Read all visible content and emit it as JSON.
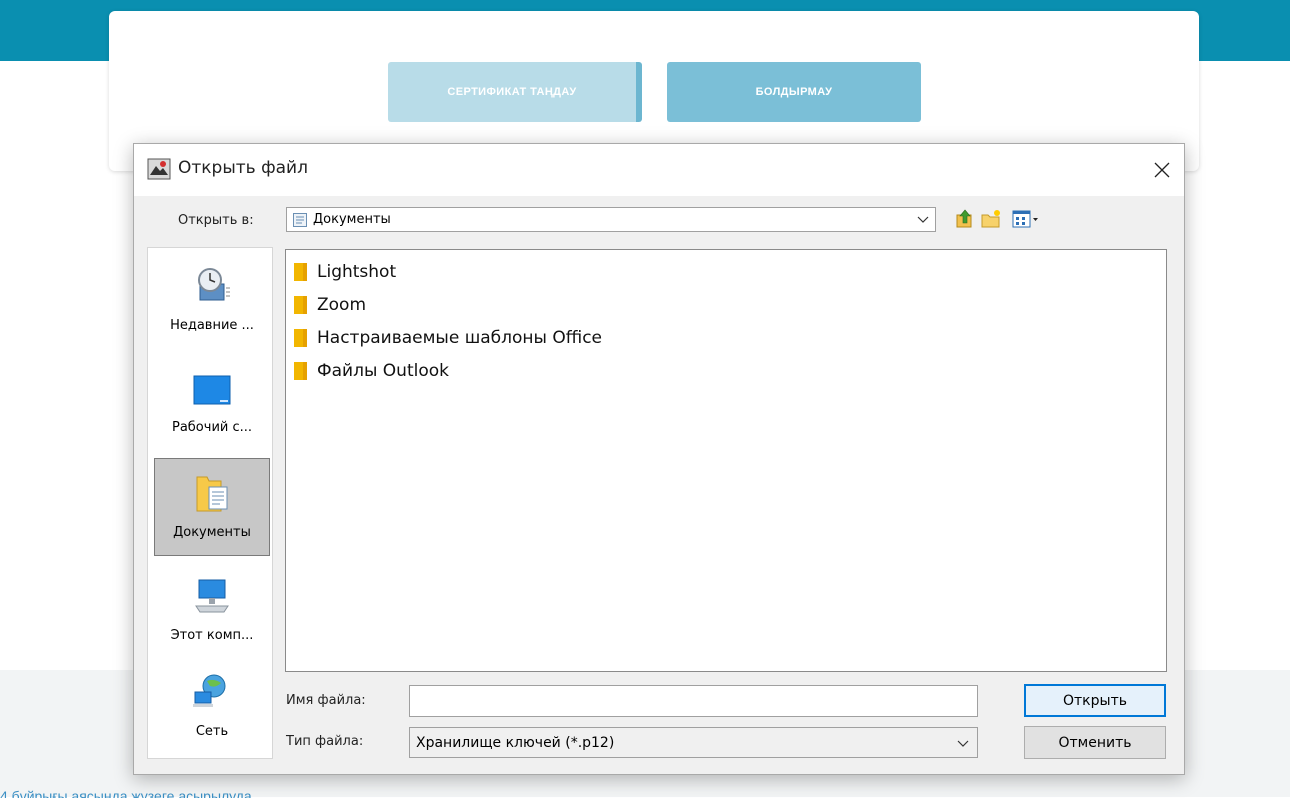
{
  "page": {
    "select_certificate_label": "СЕРТИФИКАТ ТАҢДАУ",
    "cancel_label": "БОЛДЫРМАУ",
    "footer_link_text": "4 бұйрығы аясында жүзеге асырылуда"
  },
  "dialog": {
    "title": "Открыть файл",
    "look_in_label": "Открыть в:",
    "look_in_value": "Документы",
    "places": [
      {
        "label": "Недавние ...",
        "icon": "recent-items-icon"
      },
      {
        "label": "Рабочий с...",
        "icon": "desktop-icon"
      },
      {
        "label": "Документы",
        "icon": "documents-icon",
        "selected": true
      },
      {
        "label": "Этот комп...",
        "icon": "computer-icon"
      },
      {
        "label": "Сеть",
        "icon": "network-icon"
      }
    ],
    "files": [
      "Lightshot",
      "Zoom",
      "Настраиваемые шаблоны Office",
      "Файлы Outlook"
    ],
    "file_name_label": "Имя файла:",
    "file_name_value": "",
    "file_type_label": "Тип файла:",
    "file_type_value": "Хранилище ключей (*.p12)",
    "open_button": "Открыть",
    "cancel_button": "Отменить"
  },
  "colors": {
    "brand_teal": "#0a8fb0",
    "button_light": "#b8dce8",
    "button_mid": "#7bbfd7",
    "dialog_bg": "#f0f0f0",
    "link_blue": "#3b8fc4"
  }
}
